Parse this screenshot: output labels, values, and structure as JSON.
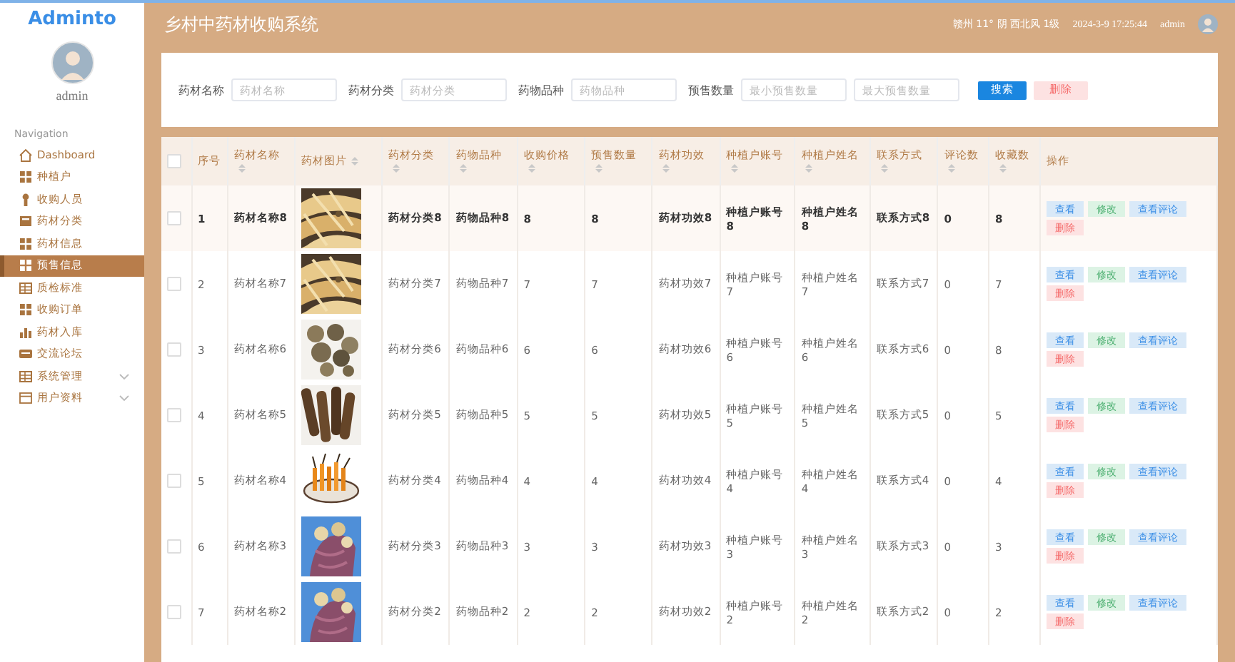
{
  "logo": "Adminto",
  "sidebar": {
    "user": "admin",
    "nav_title": "Navigation",
    "items": [
      {
        "label": "Dashboard",
        "selected": false,
        "expandable": false
      },
      {
        "label": "种植户",
        "selected": false,
        "expandable": false
      },
      {
        "label": "收购人员",
        "selected": false,
        "expandable": false
      },
      {
        "label": "药材分类",
        "selected": false,
        "expandable": false
      },
      {
        "label": "药材信息",
        "selected": false,
        "expandable": false
      },
      {
        "label": "预售信息",
        "selected": true,
        "expandable": false
      },
      {
        "label": "质检标准",
        "selected": false,
        "expandable": false
      },
      {
        "label": "收购订单",
        "selected": false,
        "expandable": false
      },
      {
        "label": "药材入库",
        "selected": false,
        "expandable": false
      },
      {
        "label": "交流论坛",
        "selected": false,
        "expandable": false
      },
      {
        "label": "系统管理",
        "selected": false,
        "expandable": true
      },
      {
        "label": "用户资料",
        "selected": false,
        "expandable": true
      }
    ]
  },
  "header": {
    "title": "乡村中药材收购系统",
    "weather": "赣州 11° 阴 西北风 1级",
    "datetime": "2024-3-9 17:25:44",
    "user": "admin"
  },
  "search": {
    "fields": [
      {
        "label": "药材名称",
        "placeholder": "药材名称"
      },
      {
        "label": "药材分类",
        "placeholder": "药材分类"
      },
      {
        "label": "药物品种",
        "placeholder": "药物品种"
      },
      {
        "label": "预售数量",
        "placeholder": "最小预售数量"
      },
      {
        "placeholder": "最大预售数量"
      }
    ],
    "buttons": [
      {
        "label": "搜索",
        "kind": "primary"
      },
      {
        "label": "删除",
        "kind": "danger"
      }
    ]
  },
  "table": {
    "columns": [
      {
        "kind": "checkbox",
        "checked": false
      },
      {
        "kind": "text",
        "label": "序号",
        "sortable": false
      },
      {
        "kind": "text",
        "label": "药材名称",
        "sortable": true
      },
      {
        "kind": "picture",
        "label": "药材图片",
        "sortable": true
      },
      {
        "kind": "text",
        "label": "药材分类",
        "sortable": true
      },
      {
        "kind": "text",
        "label": "药物品种",
        "sortable": true
      },
      {
        "kind": "text",
        "label": "收购价格",
        "sortable": true
      },
      {
        "kind": "text",
        "label": "预售数量",
        "sortable": true
      },
      {
        "kind": "text",
        "label": "药材功效",
        "sortable": true
      },
      {
        "kind": "text",
        "label": "种植户账号",
        "sortable": true
      },
      {
        "kind": "text",
        "label": "种植户姓名",
        "sortable": true
      },
      {
        "kind": "text",
        "label": "联系方式",
        "sortable": true
      },
      {
        "kind": "text",
        "label": "评论数",
        "sortable": true
      },
      {
        "kind": "text",
        "label": "收藏数",
        "sortable": true
      },
      {
        "kind": "actions",
        "label": "操作",
        "sortable": false
      }
    ],
    "rows": [
      {
        "selected": true,
        "cells": [
          {
            "checked": false
          },
          "1",
          "药材名称8",
          {
            "kind": "picture"
          },
          "药材分类8",
          "药物品种8",
          "8",
          "8",
          "药材功效8",
          "种植户账号8",
          "种植户姓名8",
          "联系方式8",
          "0",
          "8",
          {
            "buttons": [
              {
                "label": "查看",
                "kind": "info"
              },
              {
                "label": "修改",
                "kind": "success"
              },
              {
                "label": "查看评论",
                "kind": "info"
              },
              {
                "label": "删除",
                "kind": "danger"
              }
            ]
          }
        ]
      },
      {
        "selected": false,
        "cells": [
          {
            "checked": false
          },
          "2",
          "药材名称7",
          {
            "kind": "picture"
          },
          "药材分类7",
          "药物品种7",
          "7",
          "7",
          "药材功效7",
          "种植户账号7",
          "种植户姓名7",
          "联系方式7",
          "0",
          "7",
          {
            "buttons": [
              {
                "label": "查看",
                "kind": "info"
              },
              {
                "label": "修改",
                "kind": "success"
              },
              {
                "label": "查看评论",
                "kind": "info"
              },
              {
                "label": "删除",
                "kind": "danger"
              }
            ]
          }
        ]
      },
      {
        "selected": false,
        "cells": [
          {
            "checked": false
          },
          "3",
          "药材名称6",
          {
            "kind": "picture"
          },
          "药材分类6",
          "药物品种6",
          "6",
          "6",
          "药材功效6",
          "种植户账号6",
          "种植户姓名6",
          "联系方式6",
          "0",
          "8",
          {
            "buttons": [
              {
                "label": "查看",
                "kind": "info"
              },
              {
                "label": "修改",
                "kind": "success"
              },
              {
                "label": "查看评论",
                "kind": "info"
              },
              {
                "label": "删除",
                "kind": "danger"
              }
            ]
          }
        ]
      },
      {
        "selected": false,
        "cells": [
          {
            "checked": false
          },
          "4",
          "药材名称5",
          {
            "kind": "picture"
          },
          "药材分类5",
          "药物品种5",
          "5",
          "5",
          "药材功效5",
          "种植户账号5",
          "种植户姓名5",
          "联系方式5",
          "0",
          "5",
          {
            "buttons": [
              {
                "label": "查看",
                "kind": "info"
              },
              {
                "label": "修改",
                "kind": "success"
              },
              {
                "label": "查看评论",
                "kind": "info"
              },
              {
                "label": "删除",
                "kind": "danger"
              }
            ]
          }
        ]
      },
      {
        "selected": false,
        "cells": [
          {
            "checked": false
          },
          "5",
          "药材名称4",
          {
            "kind": "picture"
          },
          "药材分类4",
          "药物品种4",
          "4",
          "4",
          "药材功效4",
          "种植户账号4",
          "种植户姓名4",
          "联系方式4",
          "0",
          "4",
          {
            "buttons": [
              {
                "label": "查看",
                "kind": "info"
              },
              {
                "label": "修改",
                "kind": "success"
              },
              {
                "label": "查看评论",
                "kind": "info"
              },
              {
                "label": "删除",
                "kind": "danger"
              }
            ]
          }
        ]
      },
      {
        "selected": false,
        "cells": [
          {
            "checked": false
          },
          "6",
          "药材名称3",
          {
            "kind": "picture"
          },
          "药材分类3",
          "药物品种3",
          "3",
          "3",
          "药材功效3",
          "种植户账号3",
          "种植户姓名3",
          "联系方式3",
          "0",
          "3",
          {
            "buttons": [
              {
                "label": "查看",
                "kind": "info"
              },
              {
                "label": "修改",
                "kind": "success"
              },
              {
                "label": "查看评论",
                "kind": "info"
              },
              {
                "label": "删除",
                "kind": "danger"
              }
            ]
          }
        ]
      },
      {
        "selected": false,
        "cells": [
          {
            "checked": false
          },
          "7",
          "药材名称2",
          {
            "kind": "picture"
          },
          "药材分类2",
          "药物品种2",
          "2",
          "2",
          "药材功效2",
          "种植户账号2",
          "种植户姓名2",
          "联系方式2",
          "0",
          "2",
          {
            "buttons": [
              {
                "label": "查看",
                "kind": "info"
              },
              {
                "label": "修改",
                "kind": "success"
              },
              {
                "label": "查看评论",
                "kind": "info"
              },
              {
                "label": "删除",
                "kind": "danger"
              }
            ]
          }
        ]
      }
    ]
  }
}
